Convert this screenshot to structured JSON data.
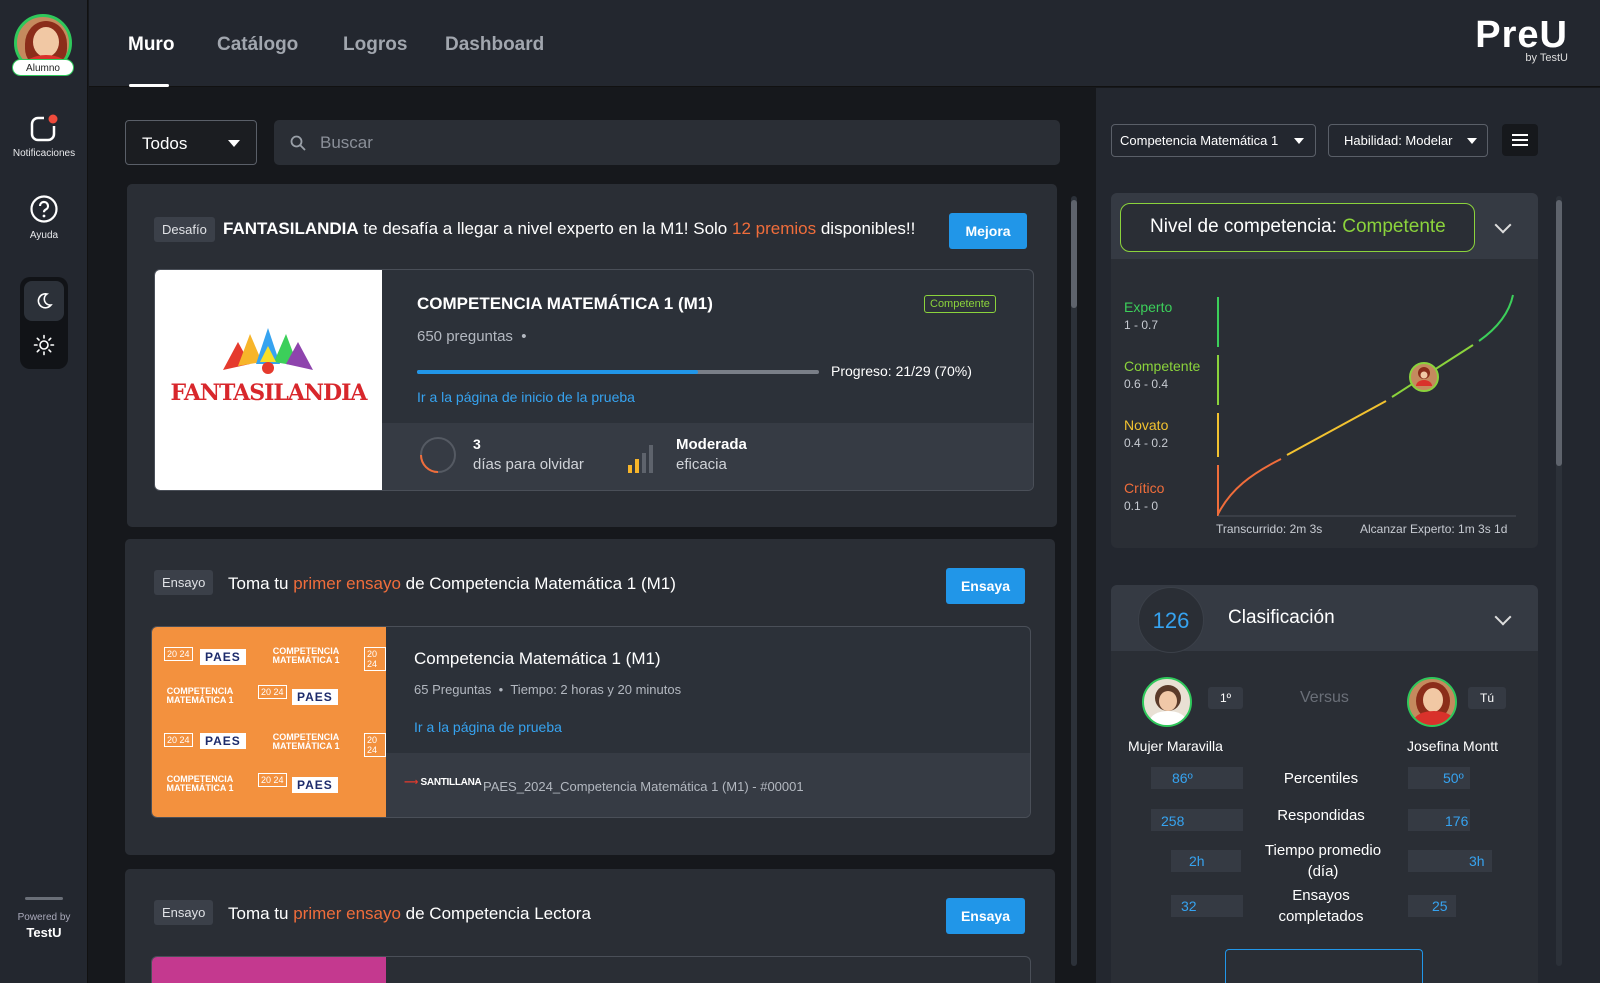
{
  "sidebar": {
    "avatar_badge": "Alumno",
    "notifications_label": "Notificaciones",
    "help_label": "Ayuda",
    "powered_by": "Powered by",
    "powered_brand": "TestU"
  },
  "nav": {
    "tabs": [
      {
        "label": "Muro"
      },
      {
        "label": "Catálogo"
      },
      {
        "label": "Logros"
      },
      {
        "label": "Dashboard"
      }
    ],
    "active": "Muro"
  },
  "logo": {
    "name": "PreU",
    "sub": "by TestU"
  },
  "filter": {
    "selected": "Todos"
  },
  "search": {
    "placeholder": "Buscar"
  },
  "feed": {
    "challenge": {
      "tag": "Desafío",
      "brand": "FANTASILANDIA",
      "text1": "te desafía a llegar a nivel experto en la M1! Solo",
      "highlight": "12 premios",
      "text2": "disponibles!!",
      "button": "Mejora",
      "logo_text": "FANTASILANDIA",
      "test_title": "COMPETENCIA MATEMÁTICA 1 (M1)",
      "badge": "Competente",
      "questions": "650 preguntas",
      "progress_label": "Progreso: 21/29 (70%)",
      "progress_value": 0.7,
      "link": "Ir a la página de inicio de la prueba",
      "forget_num": "3",
      "forget_label": "días para olvidar",
      "eff_title": "Moderada",
      "eff_label": "eficacia"
    },
    "essay1": {
      "tag": "Ensayo",
      "text1": "Toma tu",
      "highlight": "primer ensayo",
      "text2": "de Competencia Matemática 1 (M1)",
      "button": "Ensaya",
      "title": "Competencia Matemática 1 (M1)",
      "meta1": "65 Preguntas",
      "meta2": "Tiempo: 2 horas y 20 minutos",
      "link": "Ir a la página de prueba",
      "publisher": "SANTILLANA",
      "code": "PAES_2024_Competencia Matemática 1 (M1) - #00001",
      "paes_label": "PAES",
      "paes_subject": "COMPETENCIA MATEMÁTICA 1",
      "paes_year": "20 24"
    },
    "essay2": {
      "tag": "Ensayo",
      "text1": "Toma tu",
      "highlight": "primer ensayo",
      "text2": "de Competencia Lectora",
      "button": "Ensaya"
    }
  },
  "right": {
    "competence_select": "Competencia Matemática 1",
    "skill_select": "Habilidad: Modelar",
    "level_title": "Nivel de competencia:",
    "level_value": "Competente",
    "levels": [
      {
        "name": "Experto",
        "range": "1 - 0.7",
        "color": "#3ccf5a"
      },
      {
        "name": "Competente",
        "range": "0.6 - 0.4",
        "color": "#8bd33c"
      },
      {
        "name": "Novato",
        "range": "0.4 - 0.2",
        "color": "#f2c230"
      },
      {
        "name": "Crítico",
        "range": "0.1 - 0",
        "color": "#f06d3b"
      }
    ],
    "elapsed": "Transcurrido: 2m 3s",
    "to_expert": "Alcanzar Experto: 1m 3s 1d",
    "ranking_num": "126",
    "ranking_title": "Clasificación",
    "versus": "Versus",
    "left_user": {
      "name": "Mujer Maravilla",
      "rank": "1º"
    },
    "right_user": {
      "name": "Josefina Montt",
      "rank": "Tú"
    },
    "stats": [
      {
        "label": "Percentiles",
        "left": "86º",
        "right": "50º"
      },
      {
        "label": "Respondidas",
        "left": "258",
        "right": "176"
      },
      {
        "label": "Tiempo promedio (día)",
        "left": "2h",
        "right": "3h"
      },
      {
        "label": "Ensayos completados",
        "left": "32",
        "right": "25"
      }
    ]
  },
  "colors": {
    "accent": "#2196e8",
    "highlight": "#f06d3b",
    "green": "#8bd33c"
  }
}
